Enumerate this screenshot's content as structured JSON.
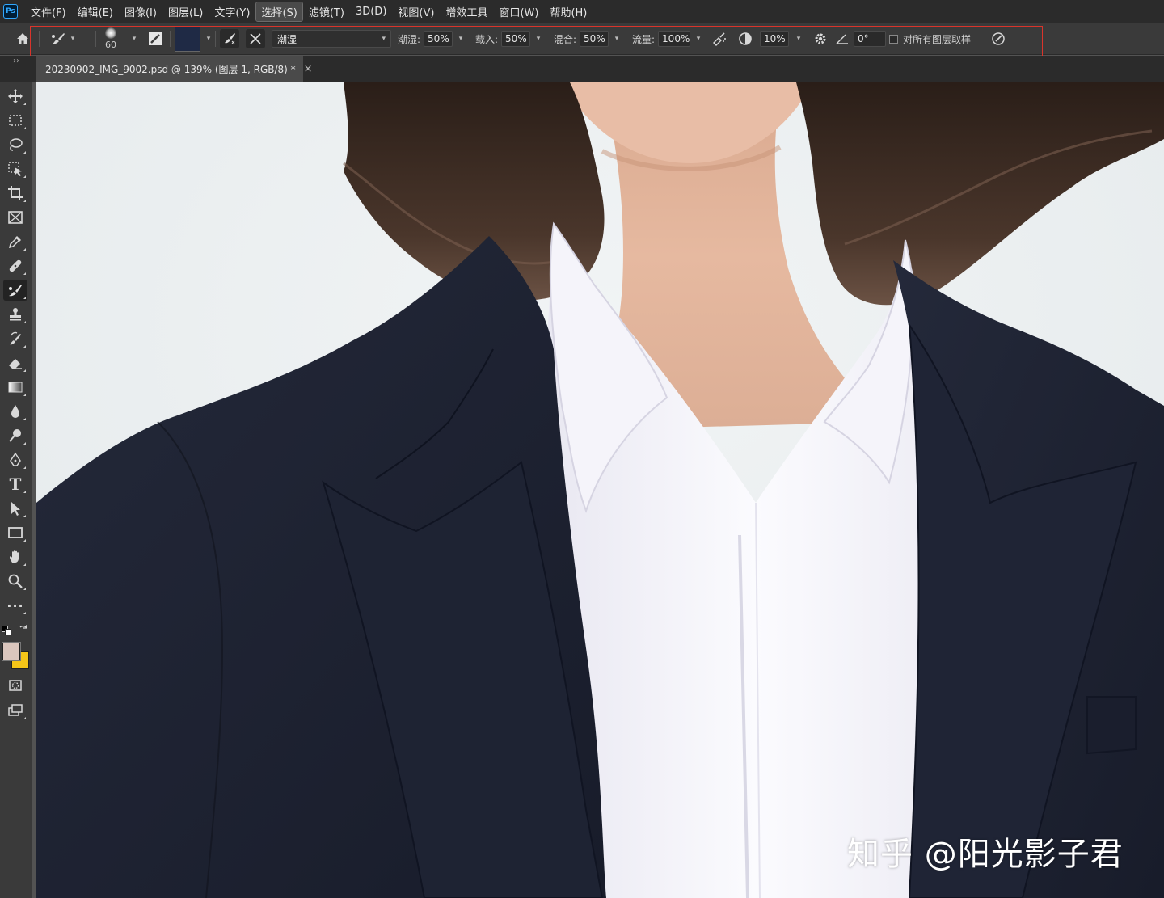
{
  "app": {
    "logo": "Ps"
  },
  "menu": [
    {
      "label": "文件(F)"
    },
    {
      "label": "编辑(E)"
    },
    {
      "label": "图像(I)"
    },
    {
      "label": "图层(L)"
    },
    {
      "label": "文字(Y)"
    },
    {
      "label": "选择(S)",
      "active": true
    },
    {
      "label": "滤镜(T)"
    },
    {
      "label": "3D(D)"
    },
    {
      "label": "视图(V)"
    },
    {
      "label": "增效工具"
    },
    {
      "label": "窗口(W)"
    },
    {
      "label": "帮助(H)"
    }
  ],
  "options": {
    "brush_size": "60",
    "brush_color": "#1f2a45",
    "mix_preset": "潮湿",
    "wet_label": "潮湿:",
    "wet_value": "50%",
    "load_label": "载入:",
    "load_value": "50%",
    "mix_label": "混合:",
    "mix_value": "50%",
    "flow_label": "流量:",
    "flow_value": "100%",
    "smoothing_value": "10%",
    "angle_value": "0°",
    "sample_all_label": "对所有图层取样"
  },
  "document_tab": {
    "title": "20230902_IMG_9002.psd @ 139% (图层 1, RGB/8) *",
    "close_glyph": "×"
  },
  "toolbar": {
    "collapse_glyph": "››",
    "foreground_color": "#dbc6bd",
    "background_color": "#f5c518",
    "tools": [
      "move-tool-icon",
      "marquee-tool-icon",
      "lasso-tool-icon",
      "object-select-tool-icon",
      "crop-tool-icon",
      "frame-tool-icon",
      "eyedropper-tool-icon",
      "healing-brush-tool-icon",
      "mixer-brush-tool-icon",
      "clone-stamp-tool-icon",
      "history-brush-tool-icon",
      "eraser-tool-icon",
      "gradient-tool-icon",
      "blur-tool-icon",
      "dodge-tool-icon",
      "pen-tool-icon",
      "type-tool-icon",
      "path-select-tool-icon",
      "rectangle-tool-icon",
      "hand-tool-icon",
      "zoom-tool-icon",
      "more-tools-icon"
    ],
    "type_tool_glyph": "T",
    "more_glyph": "···"
  },
  "watermark": {
    "text": "知乎 @阳光影子君"
  }
}
